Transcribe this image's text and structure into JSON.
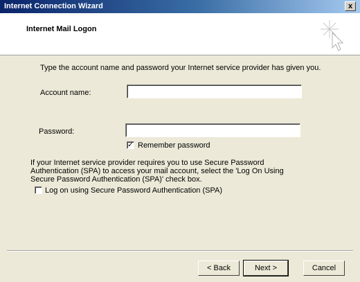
{
  "window": {
    "title": "Internet Connection Wizard",
    "close_glyph": "x"
  },
  "header": {
    "title": "Internet Mail Logon",
    "icon": "wizard-sparkle-icon"
  },
  "main": {
    "instruction": "Type the account name and password your Internet service provider has given you.",
    "account_label": "Account name:",
    "account_value": "",
    "password_label": "Password:",
    "password_value": "",
    "remember_label": "Remember password",
    "remember_checked": true,
    "spa_text": "If your Internet service provider requires you to use Secure Password Authentication (SPA) to access your mail account, select the 'Log On Using Secure Password Authentication (SPA)' check box.",
    "spa_label": "Log on using Secure Password Authentication (SPA)",
    "spa_checked": false
  },
  "buttons": {
    "back": "< Back",
    "next": "Next >",
    "cancel": "Cancel"
  }
}
